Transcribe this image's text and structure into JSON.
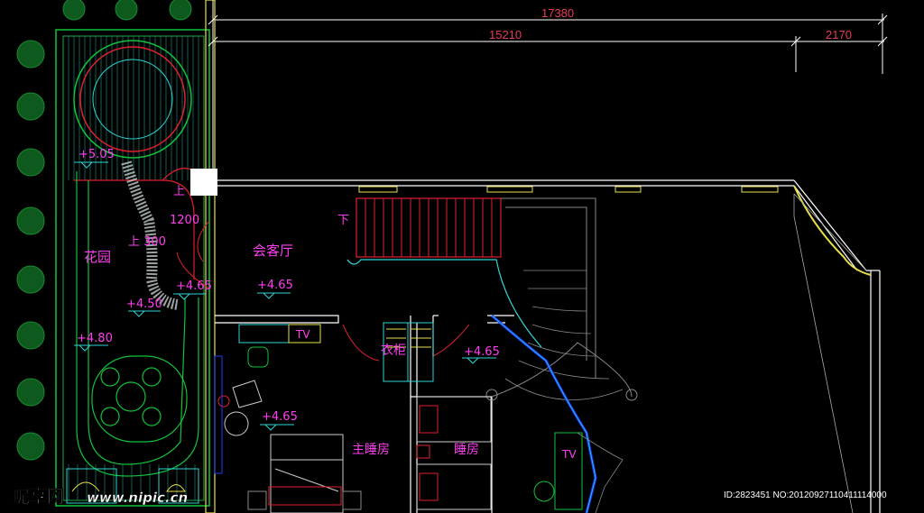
{
  "dimensions": {
    "total": "17380",
    "left_span": "15210",
    "right_span": "2170"
  },
  "rooms": {
    "garden": "花园",
    "living_room": "会客厅",
    "wardrobe": "衣柜",
    "master_bedroom": "主睡房",
    "bedroom": "睡房"
  },
  "elevations": {
    "e505": "+5.05",
    "e465_garden_door": "+4.65",
    "e465_living": "+4.65",
    "e450": "+4.50",
    "e480": "+4.80",
    "e465_hall": "+4.65",
    "e465_master": "+4.65"
  },
  "annotations": {
    "up_top": "上",
    "width_1200": "1200",
    "up_300": "上 300",
    "down": "下",
    "tv_master": "TV",
    "tv_right": "TV"
  },
  "watermark": {
    "brand": "昵享网",
    "url": "www.nipic.cn",
    "id": "ID:2823451 NO:20120927110411114000"
  },
  "colors": {
    "background": "#000000",
    "wall": "#ffffff",
    "garden_green": "#12c23a",
    "cyan": "#2fd5d5",
    "red": "#e0202e",
    "magenta": "#ff3df0",
    "yellow": "#e8e04a",
    "blue": "#1e3cff"
  }
}
